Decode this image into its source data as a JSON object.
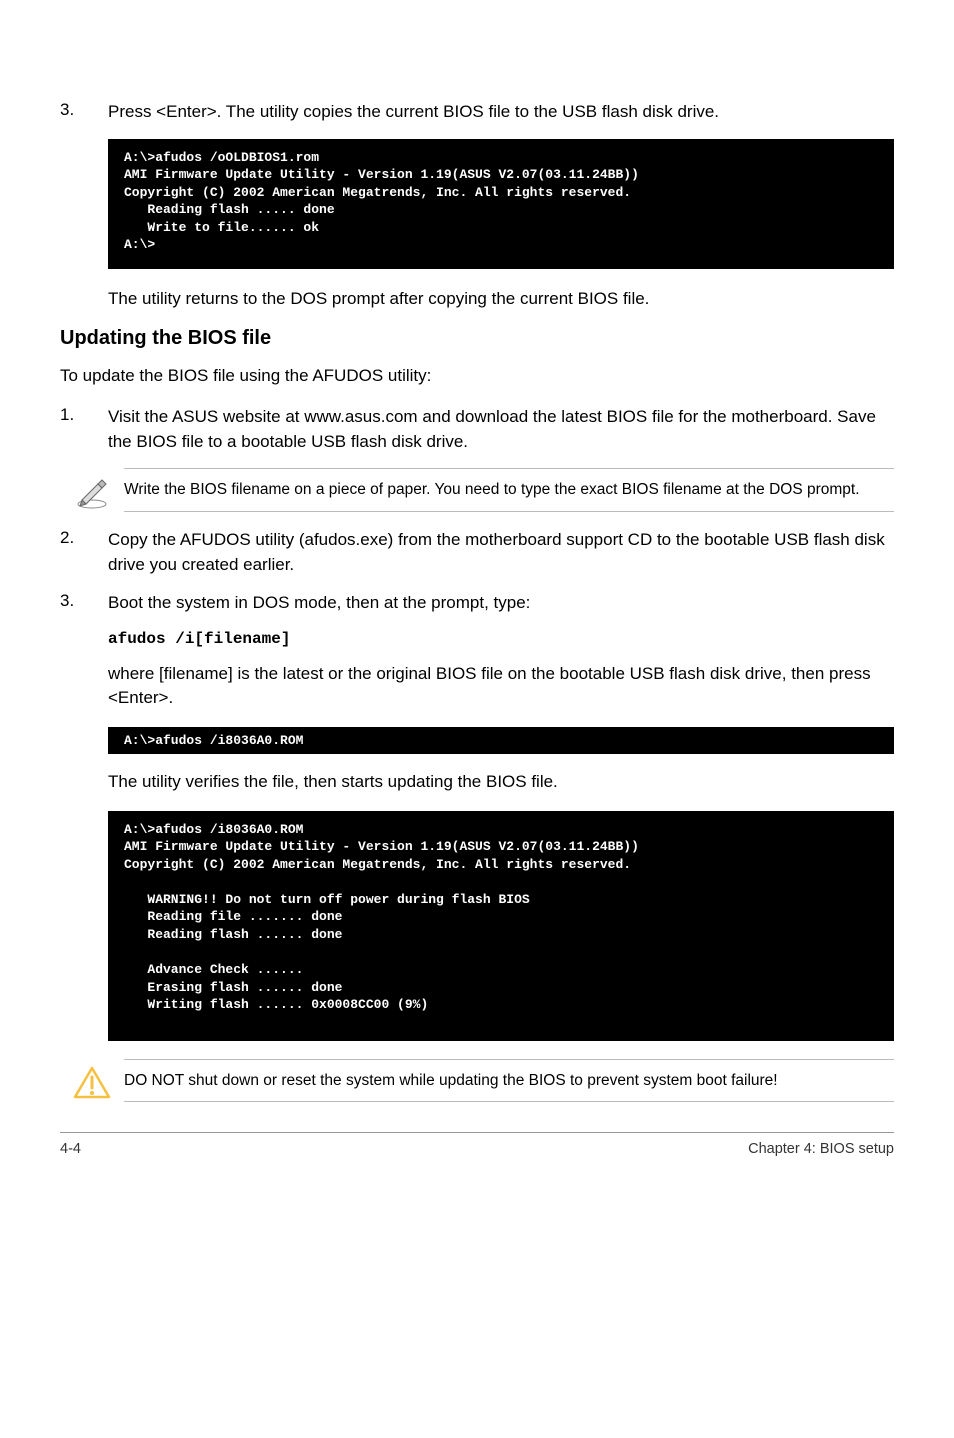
{
  "step3": {
    "num": "3.",
    "text": "Press <Enter>. The utility copies the current BIOS file to the USB flash disk drive."
  },
  "terminal1": "A:\\>afudos /oOLDBIOS1.rom\nAMI Firmware Update Utility - Version 1.19(ASUS V2.07(03.11.24BB))\nCopyright (C) 2002 American Megatrends, Inc. All rights reserved.\n   Reading flash ..... done\n   Write to file...... ok\nA:\\>",
  "after_term1": "The utility returns to the DOS prompt after copying the current BIOS file.",
  "heading": "Updating the BIOS file",
  "intro": "To update the BIOS file using the AFUDOS utility:",
  "step1": {
    "num": "1.",
    "text": "Visit the ASUS website at www.asus.com and download the latest BIOS file for the motherboard. Save the BIOS file to a bootable USB flash disk drive."
  },
  "note1": "Write the BIOS filename on a piece of paper. You need to type the exact BIOS filename at the DOS prompt.",
  "step2": {
    "num": "2.",
    "text": "Copy the AFUDOS utility (afudos.exe) from the motherboard support CD to the bootable USB flash disk drive you created earlier."
  },
  "step3b": {
    "num": "3.",
    "text": "Boot the system in DOS mode, then at the prompt, type:"
  },
  "code1": "afudos /i[filename]",
  "where_text": "where [filename] is the latest or the original BIOS file on the bootable USB flash disk drive, then press <Enter>.",
  "terminal2": "A:\\>afudos /i8036A0.ROM",
  "verify_text": "The utility verifies the file, then starts updating the BIOS file.",
  "terminal3": "A:\\>afudos /i8036A0.ROM\nAMI Firmware Update Utility - Version 1.19(ASUS V2.07(03.11.24BB))\nCopyright (C) 2002 American Megatrends, Inc. All rights reserved.\n\n   WARNING!! Do not turn off power during flash BIOS\n   Reading file ....... done\n   Reading flash ...... done\n\n   Advance Check ......\n   Erasing flash ...... done\n   Writing flash ...... 0x0008CC00 (9%)",
  "warning": "DO NOT shut down or reset the system while updating the BIOS to prevent system boot failure!",
  "footer_left": "4-4",
  "footer_right": "Chapter 4: BIOS setup"
}
